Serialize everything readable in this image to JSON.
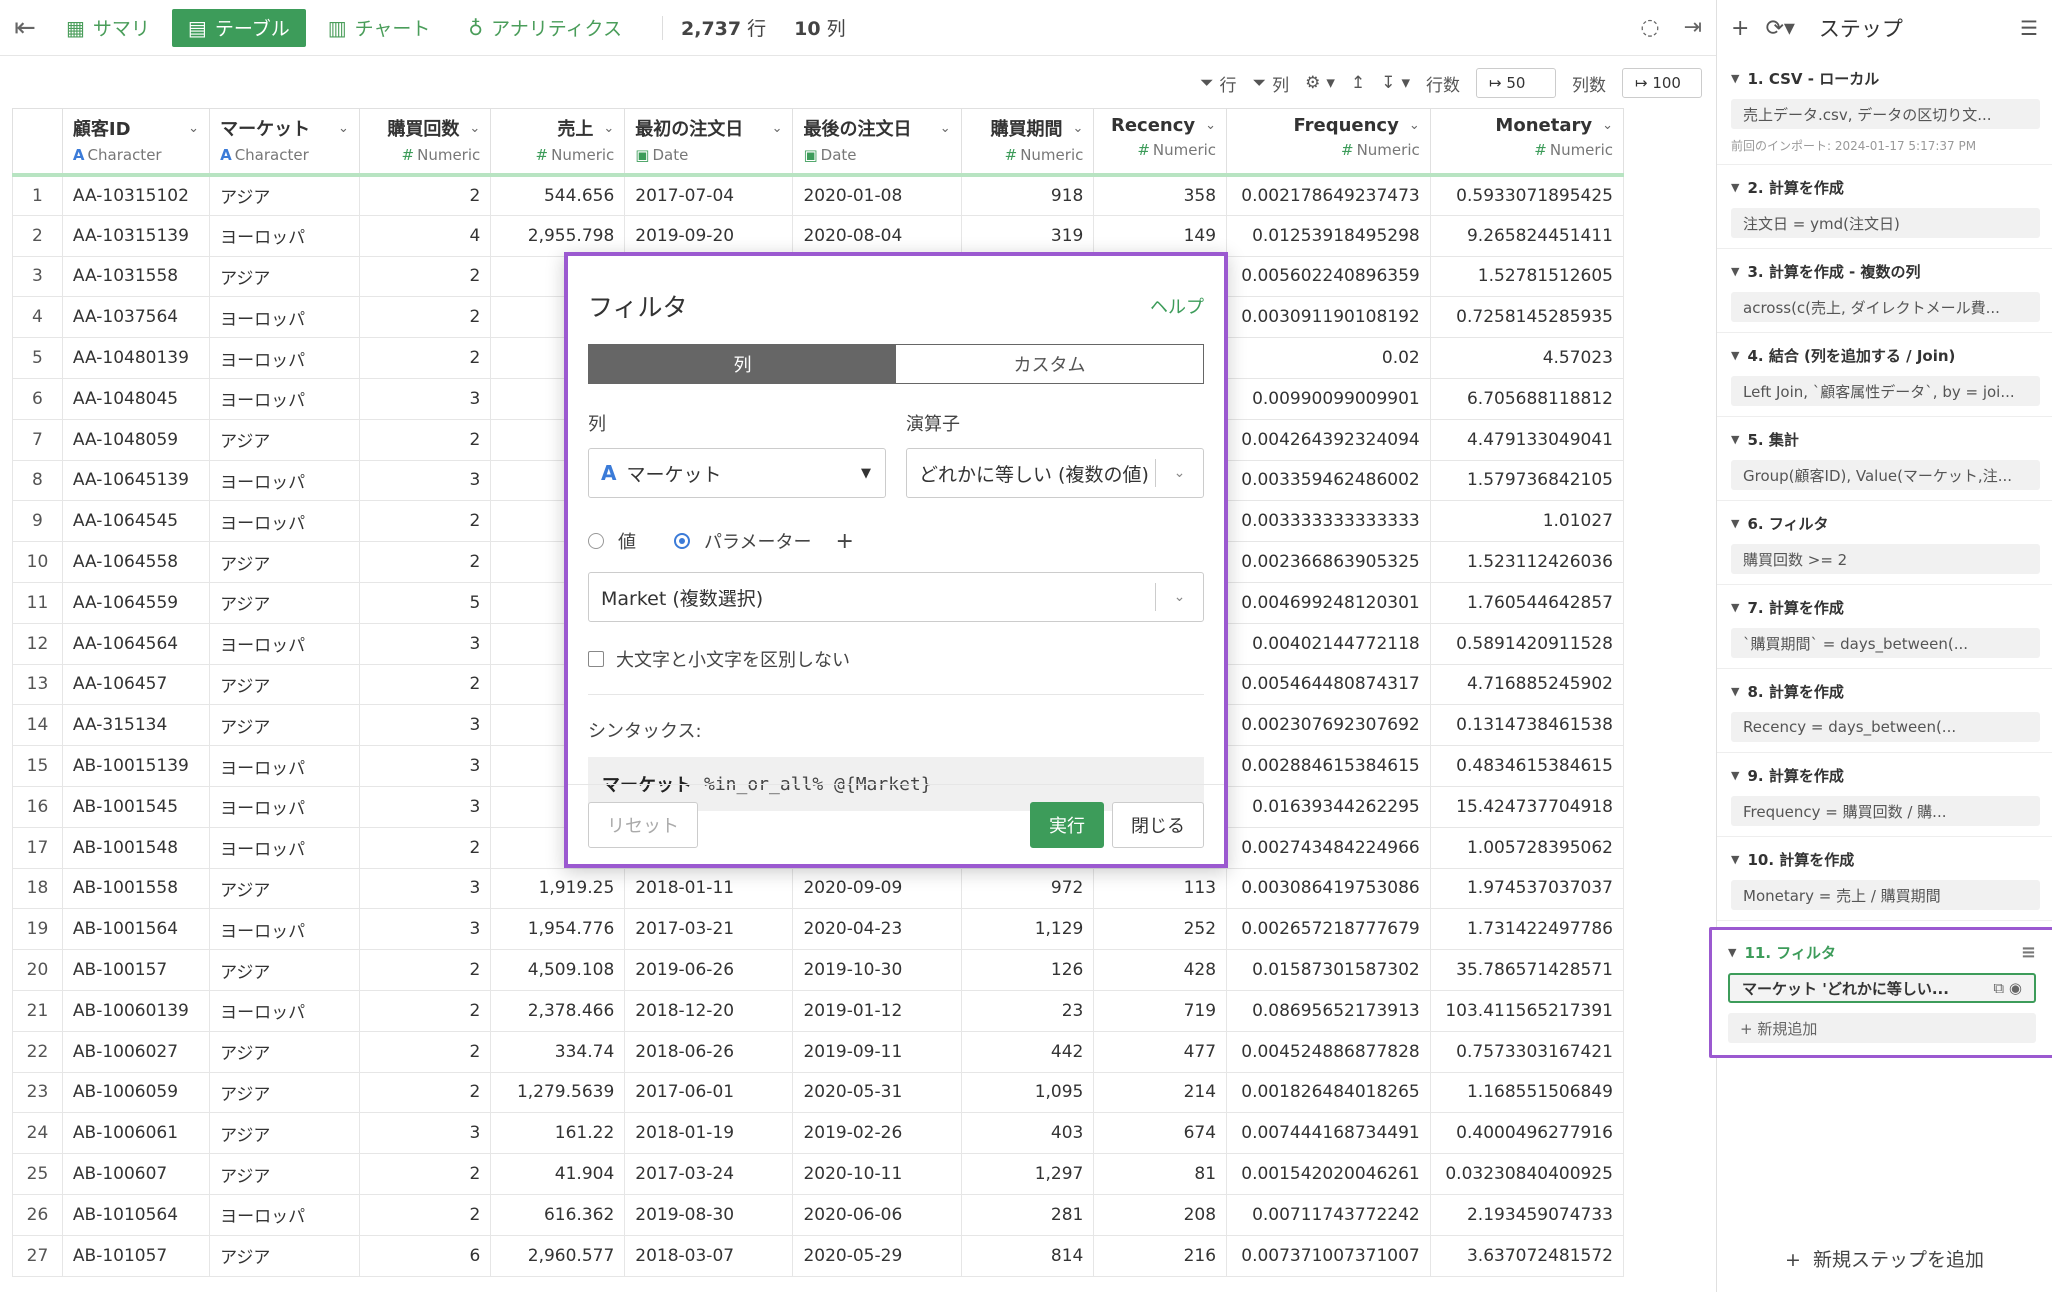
{
  "toolbar": {
    "tabs": [
      {
        "label": "サマリ",
        "icon": "table-grid-icon"
      },
      {
        "label": "テーブル",
        "icon": "table-icon"
      },
      {
        "label": "チャート",
        "icon": "bar-chart-icon"
      },
      {
        "label": "アナリティクス",
        "icon": "lightbulb-icon"
      }
    ],
    "rows_count": "2,737",
    "rows_unit": "行",
    "cols_count": "10",
    "cols_unit": "列"
  },
  "subbar": {
    "filter_row": "行",
    "filter_col": "列",
    "rows_label": "行数",
    "rows_value": "50",
    "cols_label": "列数",
    "cols_value": "100"
  },
  "columns": [
    {
      "name": "顧客ID",
      "type": "Character"
    },
    {
      "name": "マーケット",
      "type": "Character"
    },
    {
      "name": "購買回数",
      "type": "Numeric"
    },
    {
      "name": "売上",
      "type": "Numeric"
    },
    {
      "name": "最初の注文日",
      "type": "Date"
    },
    {
      "name": "最後の注文日",
      "type": "Date"
    },
    {
      "name": "購買期間",
      "type": "Numeric"
    },
    {
      "name": "Recency",
      "type": "Numeric"
    },
    {
      "name": "Frequency",
      "type": "Numeric"
    },
    {
      "name": "Monetary",
      "type": "Numeric"
    }
  ],
  "rows": [
    [
      "1",
      "AA-10315102",
      "アジア",
      "2",
      "544.656",
      "2017-07-04",
      "2020-01-08",
      "918",
      "358",
      "0.002178649237473",
      "0.5933071895425"
    ],
    [
      "2",
      "AA-10315139",
      "ヨーロッパ",
      "4",
      "2,955.798",
      "2019-09-20",
      "2020-08-04",
      "319",
      "149",
      "0.01253918495298",
      "9.265824451411"
    ],
    [
      "3",
      "AA-1031558",
      "アジア",
      "2",
      "5",
      "",
      "",
      "",
      "",
      "0.005602240896359",
      "1.52781512605"
    ],
    [
      "4",
      "AA-1037564",
      "ヨーロッパ",
      "2",
      "46",
      "",
      "",
      "",
      "",
      "0.003091190108192",
      "0.7258145285935"
    ],
    [
      "5",
      "AA-10480139",
      "ヨーロッパ",
      "2",
      "45",
      "",
      "",
      "",
      "",
      "0.02",
      "4.57023"
    ],
    [
      "6",
      "AA-1048045",
      "ヨーロッパ",
      "3",
      "2,031",
      "",
      "",
      "",
      "",
      "0.00990099009901",
      "6.705688118812"
    ],
    [
      "7",
      "AA-1048059",
      "アジア",
      "2",
      "2,100",
      "",
      "",
      "",
      "",
      "0.004264392324094",
      "4.479133049041"
    ],
    [
      "8",
      "AA-10645139",
      "ヨーロッパ",
      "3",
      "1,41",
      "",
      "",
      "",
      "",
      "0.003359462486002",
      "1.579736842105"
    ],
    [
      "9",
      "AA-1064545",
      "ヨーロッパ",
      "2",
      "60",
      "",
      "",
      "",
      "",
      "0.003333333333333",
      "1.01027"
    ],
    [
      "10",
      "AA-1064558",
      "アジア",
      "2",
      "1,2",
      "",
      "",
      "",
      "",
      "0.002366863905325",
      "1.523112426036"
    ],
    [
      "11",
      "AA-1064559",
      "アジア",
      "5",
      "1,873",
      "",
      "",
      "",
      "",
      "0.004699248120301",
      "1.760544642857"
    ],
    [
      "12",
      "AA-1064564",
      "ヨーロッパ",
      "3",
      "",
      "",
      "",
      "",
      "",
      "0.00402144772118",
      "0.5891420911528"
    ],
    [
      "13",
      "AA-106457",
      "アジア",
      "2",
      "1,7",
      "",
      "",
      "",
      "",
      "0.005464480874317",
      "4.716885245902"
    ],
    [
      "14",
      "AA-315134",
      "アジア",
      "3",
      "17",
      "",
      "",
      "",
      "",
      "0.002307692307692",
      "0.1314738461538"
    ],
    [
      "15",
      "AB-10015139",
      "ヨーロッパ",
      "3",
      "",
      "",
      "",
      "",
      "",
      "0.002884615384615",
      "0.4834615384615"
    ],
    [
      "16",
      "AB-1001545",
      "ヨーロッパ",
      "3",
      "2,82",
      "",
      "",
      "",
      "",
      "0.01639344262295",
      "15.424737704918"
    ],
    [
      "17",
      "AB-1001548",
      "ヨーロッパ",
      "2",
      "73",
      "",
      "",
      "",
      "",
      "0.002743484224966",
      "1.005728395062"
    ],
    [
      "18",
      "AB-1001558",
      "アジア",
      "3",
      "1,919.25",
      "2018-01-11",
      "2020-09-09",
      "972",
      "113",
      "0.003086419753086",
      "1.974537037037"
    ],
    [
      "19",
      "AB-1001564",
      "ヨーロッパ",
      "3",
      "1,954.776",
      "2017-03-21",
      "2020-04-23",
      "1,129",
      "252",
      "0.002657218777679",
      "1.731422497786"
    ],
    [
      "20",
      "AB-100157",
      "アジア",
      "2",
      "4,509.108",
      "2019-06-26",
      "2019-10-30",
      "126",
      "428",
      "0.01587301587302",
      "35.786571428571"
    ],
    [
      "21",
      "AB-10060139",
      "ヨーロッパ",
      "2",
      "2,378.466",
      "2018-12-20",
      "2019-01-12",
      "23",
      "719",
      "0.08695652173913",
      "103.411565217391"
    ],
    [
      "22",
      "AB-1006027",
      "アジア",
      "2",
      "334.74",
      "2018-06-26",
      "2019-09-11",
      "442",
      "477",
      "0.004524886877828",
      "0.7573303167421"
    ],
    [
      "23",
      "AB-1006059",
      "アジア",
      "2",
      "1,279.5639",
      "2017-06-01",
      "2020-05-31",
      "1,095",
      "214",
      "0.001826484018265",
      "1.168551506849"
    ],
    [
      "24",
      "AB-1006061",
      "アジア",
      "3",
      "161.22",
      "2018-01-19",
      "2019-02-26",
      "403",
      "674",
      "0.007444168734491",
      "0.4000496277916"
    ],
    [
      "25",
      "AB-100607",
      "アジア",
      "2",
      "41.904",
      "2017-03-24",
      "2020-10-11",
      "1,297",
      "81",
      "0.001542020046261",
      "0.03230840400925"
    ],
    [
      "26",
      "AB-1010564",
      "ヨーロッパ",
      "2",
      "616.362",
      "2019-08-30",
      "2020-06-06",
      "281",
      "208",
      "0.00711743772242",
      "2.193459074733"
    ],
    [
      "27",
      "AB-101057",
      "アジア",
      "6",
      "2,960.577",
      "2018-03-07",
      "2020-05-29",
      "814",
      "216",
      "0.007371007371007",
      "3.637072481572"
    ]
  ],
  "steps_panel": {
    "title": "ステップ",
    "steps": [
      {
        "title": "1. CSV - ローカル",
        "body": "売上データ.csv, データの区切り文...",
        "meta": "前回のインポート: 2024-01-17 5:17:37 PM"
      },
      {
        "title": "2. 計算を作成",
        "body": "注文日 = ymd(注文日)"
      },
      {
        "title": "3. 計算を作成 - 複数の列",
        "body": "across(c(売上, ダイレクトメール費..."
      },
      {
        "title": "4. 結合 (列を追加する / Join)",
        "body": "Left Join, `顧客属性データ`, by = joi..."
      },
      {
        "title": "5. 集計",
        "body": "Group(顧客ID), Value(マーケット,注..."
      },
      {
        "title": "6. フィルタ",
        "body": "購買回数 >= 2"
      },
      {
        "title": "7. 計算を作成",
        "body": "`購買期間` = days_between(..."
      },
      {
        "title": "8. 計算を作成",
        "body": "Recency = days_between(..."
      },
      {
        "title": "9. 計算を作成",
        "body": "Frequency = 購買回数 / 購..."
      },
      {
        "title": "10. 計算を作成",
        "body": "Monetary = 売上 / 購買期間"
      }
    ],
    "selected_step": {
      "title": "11. フィルタ",
      "body": "マーケット 'どれかに等しい...",
      "add_label": "+ 新規追加"
    },
    "add_step_label": "新規ステップを追加"
  },
  "filter_modal": {
    "title": "フィルタ",
    "help": "ヘルプ",
    "tab_column": "列",
    "tab_custom": "カスタム",
    "column_label": "列",
    "column_value": "マーケット",
    "operator_label": "演算子",
    "operator_value": "どれかに等しい (複数の値)",
    "radio_value": "値",
    "radio_param": "パラメーター",
    "param_value": "Market (複数選択)",
    "case_label": "大文字と小文字を区別しない",
    "syntax_label": "シンタックス:",
    "syntax_col": "マーケット",
    "syntax_expr": "%in_or_all% @{Market}",
    "reset": "リセット",
    "run": "実行",
    "close": "閉じる"
  }
}
